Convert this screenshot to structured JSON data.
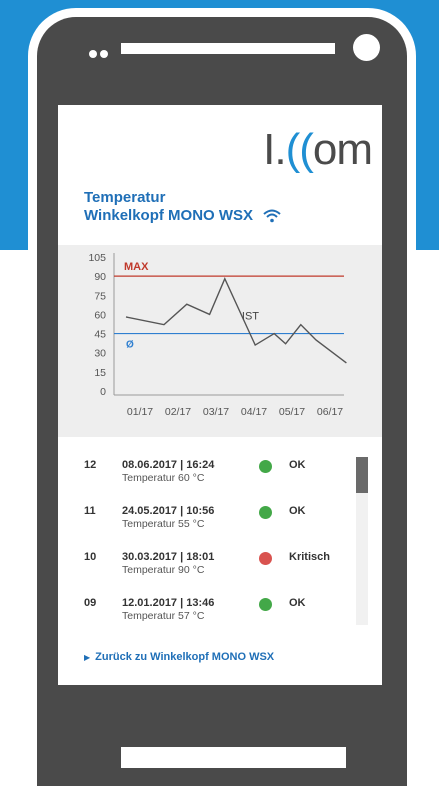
{
  "logo": {
    "text_l": "I.",
    "text_acc": "((",
    "text_r": "om"
  },
  "header": {
    "line1": "Temperatur",
    "line2": "Winkelkopf MONO WSX"
  },
  "colors": {
    "accent": "#1f8fd3",
    "title": "#1f6fb7",
    "max_line": "#c0392b",
    "avg_line": "#2f7fd0",
    "ok": "#43a848",
    "critical": "#d9534f"
  },
  "chart_data": {
    "type": "line",
    "y_ticks": [
      105,
      90,
      75,
      60,
      45,
      30,
      15,
      0
    ],
    "ylim": [
      0,
      105
    ],
    "x_ticks": [
      "01/17",
      "02/17",
      "03/17",
      "04/17",
      "05/17",
      "06/17"
    ],
    "series": [
      {
        "name": "IST",
        "x": [
          0,
          1,
          1.6,
          2.2,
          2.6,
          3.4,
          3.9,
          4.2,
          4.6,
          5.0,
          5.8
        ],
        "values": [
          58,
          52,
          68,
          60,
          88,
          36,
          45,
          37,
          52,
          40,
          22
        ]
      }
    ],
    "max_label": "MAX",
    "max_value": 90,
    "avg_label": "Ø",
    "avg_value": 45
  },
  "entries": [
    {
      "num": "12",
      "datetime": "08.06.2017 | 16:24",
      "temp": "Temperatur 60 °C",
      "status": "OK",
      "state": "ok"
    },
    {
      "num": "11",
      "datetime": "24.05.2017 | 10:56",
      "temp": "Temperatur 55 °C",
      "status": "OK",
      "state": "ok"
    },
    {
      "num": "10",
      "datetime": "30.03.2017 | 18:01",
      "temp": "Temperatur 90 °C",
      "status": "Kritisch",
      "state": "critical"
    },
    {
      "num": "09",
      "datetime": "12.01.2017 | 13:46",
      "temp": "Temperatur 57 °C",
      "status": "OK",
      "state": "ok"
    }
  ],
  "back_link": "Zurück zu Winkelkopf MONO WSX"
}
